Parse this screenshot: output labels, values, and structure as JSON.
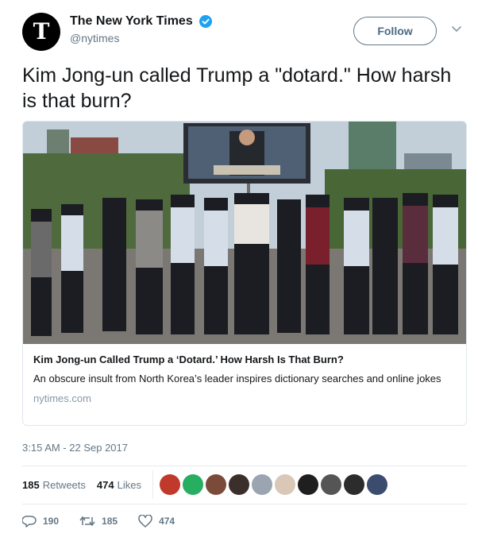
{
  "account": {
    "display_name": "The New York Times",
    "handle": "@nytimes",
    "avatar_glyph": "T",
    "verified_icon": "verified-badge-icon"
  },
  "follow_label": "Follow",
  "tweet": {
    "text": "Kim Jong-un called Trump a \"dotard.\" How harsh is that burn?"
  },
  "card": {
    "title": "Kim Jong-un Called Trump a ‘Dotard.’ How Harsh Is That Burn?",
    "description": "An obscure insult from North Korea’s leader inspires dictionary searches and online jokes",
    "domain": "nytimes.com"
  },
  "timestamp": "3:15 AM - 22 Sep 2017",
  "stats": {
    "retweets_count": "185",
    "retweets_label": "Retweets",
    "likes_count": "474",
    "likes_label": "Likes"
  },
  "likers": [
    {
      "color": "#c0392b"
    },
    {
      "color": "#27ae60"
    },
    {
      "color": "#7b4b3a"
    },
    {
      "color": "#3a2f2a"
    },
    {
      "color": "#9aa5b1"
    },
    {
      "color": "#d9c7b8"
    },
    {
      "color": "#1f1f1f"
    },
    {
      "color": "#555555"
    },
    {
      "color": "#2c2c2c"
    },
    {
      "color": "#3c4c6e"
    }
  ],
  "actions": {
    "reply_count": "190",
    "retweet_count": "185",
    "like_count": "474"
  },
  "colors": {
    "verified": "#1da1f2",
    "text": "#14171a",
    "muted": "#657786"
  }
}
